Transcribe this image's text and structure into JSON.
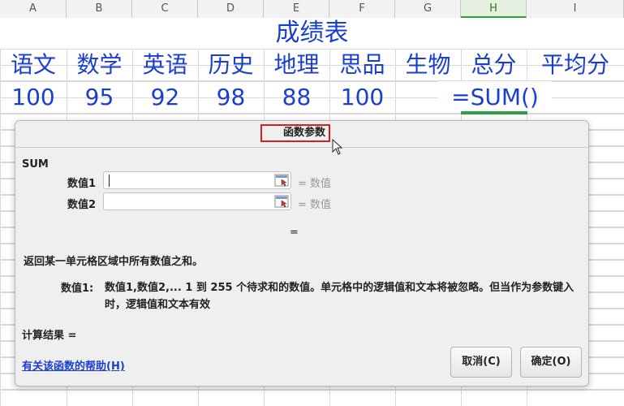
{
  "columns": [
    "A",
    "B",
    "C",
    "D",
    "E",
    "F",
    "G",
    "H",
    "I"
  ],
  "active_column": "H",
  "sheet": {
    "title": "成绩表",
    "headers": [
      "语文",
      "数学",
      "英语",
      "历史",
      "地理",
      "思品",
      "生物",
      "总分",
      "平均分"
    ],
    "values": [
      "100",
      "95",
      "92",
      "98",
      "88",
      "100"
    ],
    "formula": "=SUM()"
  },
  "dialog": {
    "title": "函数参数",
    "function_name": "SUM",
    "args": [
      {
        "label": "数值1",
        "value": "",
        "result": "= 数值"
      },
      {
        "label": "数值2",
        "value": "",
        "result": "= 数值"
      }
    ],
    "formula_result": "=",
    "description": "返回某一单元格区域中所有数值之和。",
    "param_label": "数值1:",
    "param_description": "数值1,数值2,... 1 到 255 个待求和的数值。单元格中的逻辑值和文本将被忽略。但当作为参数键入时，逻辑值和文本有效",
    "calc_result": "计算结果  =",
    "help_link": "有关该函数的帮助(H)",
    "cancel_label": "取消(C)",
    "ok_label": "确定(O)"
  },
  "colors": {
    "accent": "#2ea043",
    "cell_text": "#1a3fd0",
    "highlight": "#d62020"
  }
}
